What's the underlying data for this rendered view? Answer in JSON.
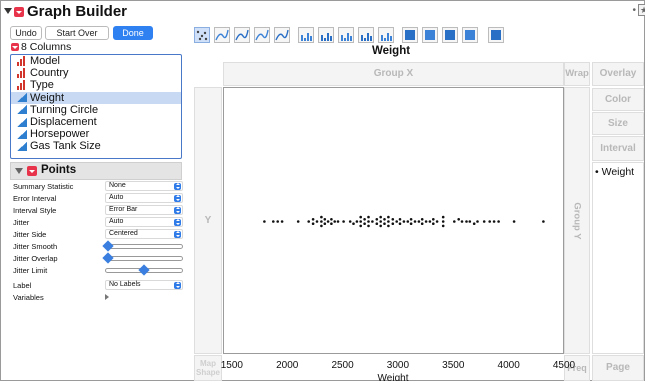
{
  "app": {
    "title": "Graph Builder"
  },
  "toolbar": {
    "undo": "Undo",
    "start_over": "Start Over",
    "done": "Done"
  },
  "columns": {
    "header": "8 Columns",
    "items": [
      {
        "label": "Model",
        "kind": "nominal",
        "selected": false
      },
      {
        "label": "Country",
        "kind": "nominal",
        "selected": false
      },
      {
        "label": "Type",
        "kind": "nominal",
        "selected": false
      },
      {
        "label": "Weight",
        "kind": "continuous",
        "selected": true
      },
      {
        "label": "Turning Circle",
        "kind": "continuous",
        "selected": false
      },
      {
        "label": "Displacement",
        "kind": "continuous",
        "selected": false
      },
      {
        "label": "Horsepower",
        "kind": "continuous",
        "selected": false
      },
      {
        "label": "Gas Tank Size",
        "kind": "continuous",
        "selected": false
      }
    ]
  },
  "points": {
    "title": "Points",
    "props": [
      {
        "label": "Summary Statistic",
        "type": "select",
        "value": "None"
      },
      {
        "label": "Error Interval",
        "type": "select",
        "value": "Auto"
      },
      {
        "label": "Interval Style",
        "type": "select",
        "value": "Error Bar"
      },
      {
        "label": "Jitter",
        "type": "select",
        "value": "Auto"
      },
      {
        "label": "Jitter Side",
        "type": "select",
        "value": "Centered"
      },
      {
        "label": "Jitter Smooth",
        "type": "slider",
        "value": 0
      },
      {
        "label": "Jitter Overlap",
        "type": "slider",
        "value": 0
      },
      {
        "label": "Jitter Limit",
        "type": "slider",
        "value": 0.5
      },
      {
        "label": "Label",
        "type": "select",
        "value": "No Labels"
      },
      {
        "label": "Variables",
        "type": "expander",
        "value": ""
      }
    ]
  },
  "graph": {
    "title": "Weight",
    "zones": {
      "group_x": "Group X",
      "wrap": "Wrap",
      "overlay": "Overlay",
      "color": "Color",
      "size": "Size",
      "interval": "Interval",
      "y": "Y",
      "group_y": "Group Y",
      "map_shape": "Map Shape",
      "freq": "Freq",
      "page": "Page"
    },
    "legend_item": "• Weight"
  },
  "colors": {
    "accent": "#2f80f0",
    "nominal": "#d2352c",
    "continuous": "#2f7fd1",
    "selection": "#c7d9f3"
  },
  "chart_data": {
    "type": "scatter",
    "title": "Weight",
    "xlabel": "Weight",
    "ylabel": "",
    "xlim": [
      1420,
      4500
    ],
    "xticks": [
      1500,
      2000,
      2500,
      3000,
      3500,
      4000,
      4500
    ],
    "grid": false,
    "points": [
      {
        "x": 1785,
        "y": 0
      },
      {
        "x": 1865,
        "y": 0
      },
      {
        "x": 1905,
        "y": 0
      },
      {
        "x": 1945,
        "y": 0
      },
      {
        "x": 2090,
        "y": 0
      },
      {
        "x": 2185,
        "y": 0
      },
      {
        "x": 2225,
        "y": -1
      },
      {
        "x": 2225,
        "y": 1
      },
      {
        "x": 2260,
        "y": 0
      },
      {
        "x": 2300,
        "y": -2
      },
      {
        "x": 2300,
        "y": 0
      },
      {
        "x": 2300,
        "y": 2
      },
      {
        "x": 2330,
        "y": -1
      },
      {
        "x": 2330,
        "y": 1
      },
      {
        "x": 2360,
        "y": 0
      },
      {
        "x": 2390,
        "y": -1
      },
      {
        "x": 2390,
        "y": 1
      },
      {
        "x": 2420,
        "y": 0
      },
      {
        "x": 2450,
        "y": 0
      },
      {
        "x": 2500,
        "y": 0
      },
      {
        "x": 2560,
        "y": 0
      },
      {
        "x": 2590,
        "y": 1
      },
      {
        "x": 2620,
        "y": 0
      },
      {
        "x": 2655,
        "y": -2
      },
      {
        "x": 2655,
        "y": 0
      },
      {
        "x": 2655,
        "y": 2
      },
      {
        "x": 2690,
        "y": -1
      },
      {
        "x": 2690,
        "y": 1
      },
      {
        "x": 2725,
        "y": -2
      },
      {
        "x": 2725,
        "y": 0
      },
      {
        "x": 2725,
        "y": 2
      },
      {
        "x": 2760,
        "y": 0
      },
      {
        "x": 2800,
        "y": -1
      },
      {
        "x": 2800,
        "y": 1
      },
      {
        "x": 2835,
        "y": -2
      },
      {
        "x": 2835,
        "y": 0
      },
      {
        "x": 2835,
        "y": 2
      },
      {
        "x": 2870,
        "y": -1
      },
      {
        "x": 2870,
        "y": 1
      },
      {
        "x": 2905,
        "y": -2
      },
      {
        "x": 2905,
        "y": 0
      },
      {
        "x": 2905,
        "y": 2
      },
      {
        "x": 2945,
        "y": -1
      },
      {
        "x": 2945,
        "y": 1
      },
      {
        "x": 2980,
        "y": 0
      },
      {
        "x": 3010,
        "y": -1
      },
      {
        "x": 3010,
        "y": 1
      },
      {
        "x": 3045,
        "y": 0
      },
      {
        "x": 3080,
        "y": 0
      },
      {
        "x": 3110,
        "y": -1
      },
      {
        "x": 3110,
        "y": 1
      },
      {
        "x": 3145,
        "y": 0
      },
      {
        "x": 3180,
        "y": 0
      },
      {
        "x": 3210,
        "y": -1
      },
      {
        "x": 3210,
        "y": 1
      },
      {
        "x": 3245,
        "y": 0
      },
      {
        "x": 3280,
        "y": 0
      },
      {
        "x": 3310,
        "y": -1
      },
      {
        "x": 3310,
        "y": 1
      },
      {
        "x": 3345,
        "y": 0
      },
      {
        "x": 3400,
        "y": -2
      },
      {
        "x": 3400,
        "y": 0
      },
      {
        "x": 3400,
        "y": 2
      },
      {
        "x": 3500,
        "y": 0
      },
      {
        "x": 3540,
        "y": -1
      },
      {
        "x": 3570,
        "y": 0
      },
      {
        "x": 3610,
        "y": 0
      },
      {
        "x": 3640,
        "y": 0
      },
      {
        "x": 3680,
        "y": 1
      },
      {
        "x": 3710,
        "y": 0
      },
      {
        "x": 3770,
        "y": 0
      },
      {
        "x": 3820,
        "y": 0
      },
      {
        "x": 3860,
        "y": 0
      },
      {
        "x": 3900,
        "y": 0
      },
      {
        "x": 4040,
        "y": 0
      },
      {
        "x": 4305,
        "y": 0
      }
    ]
  }
}
